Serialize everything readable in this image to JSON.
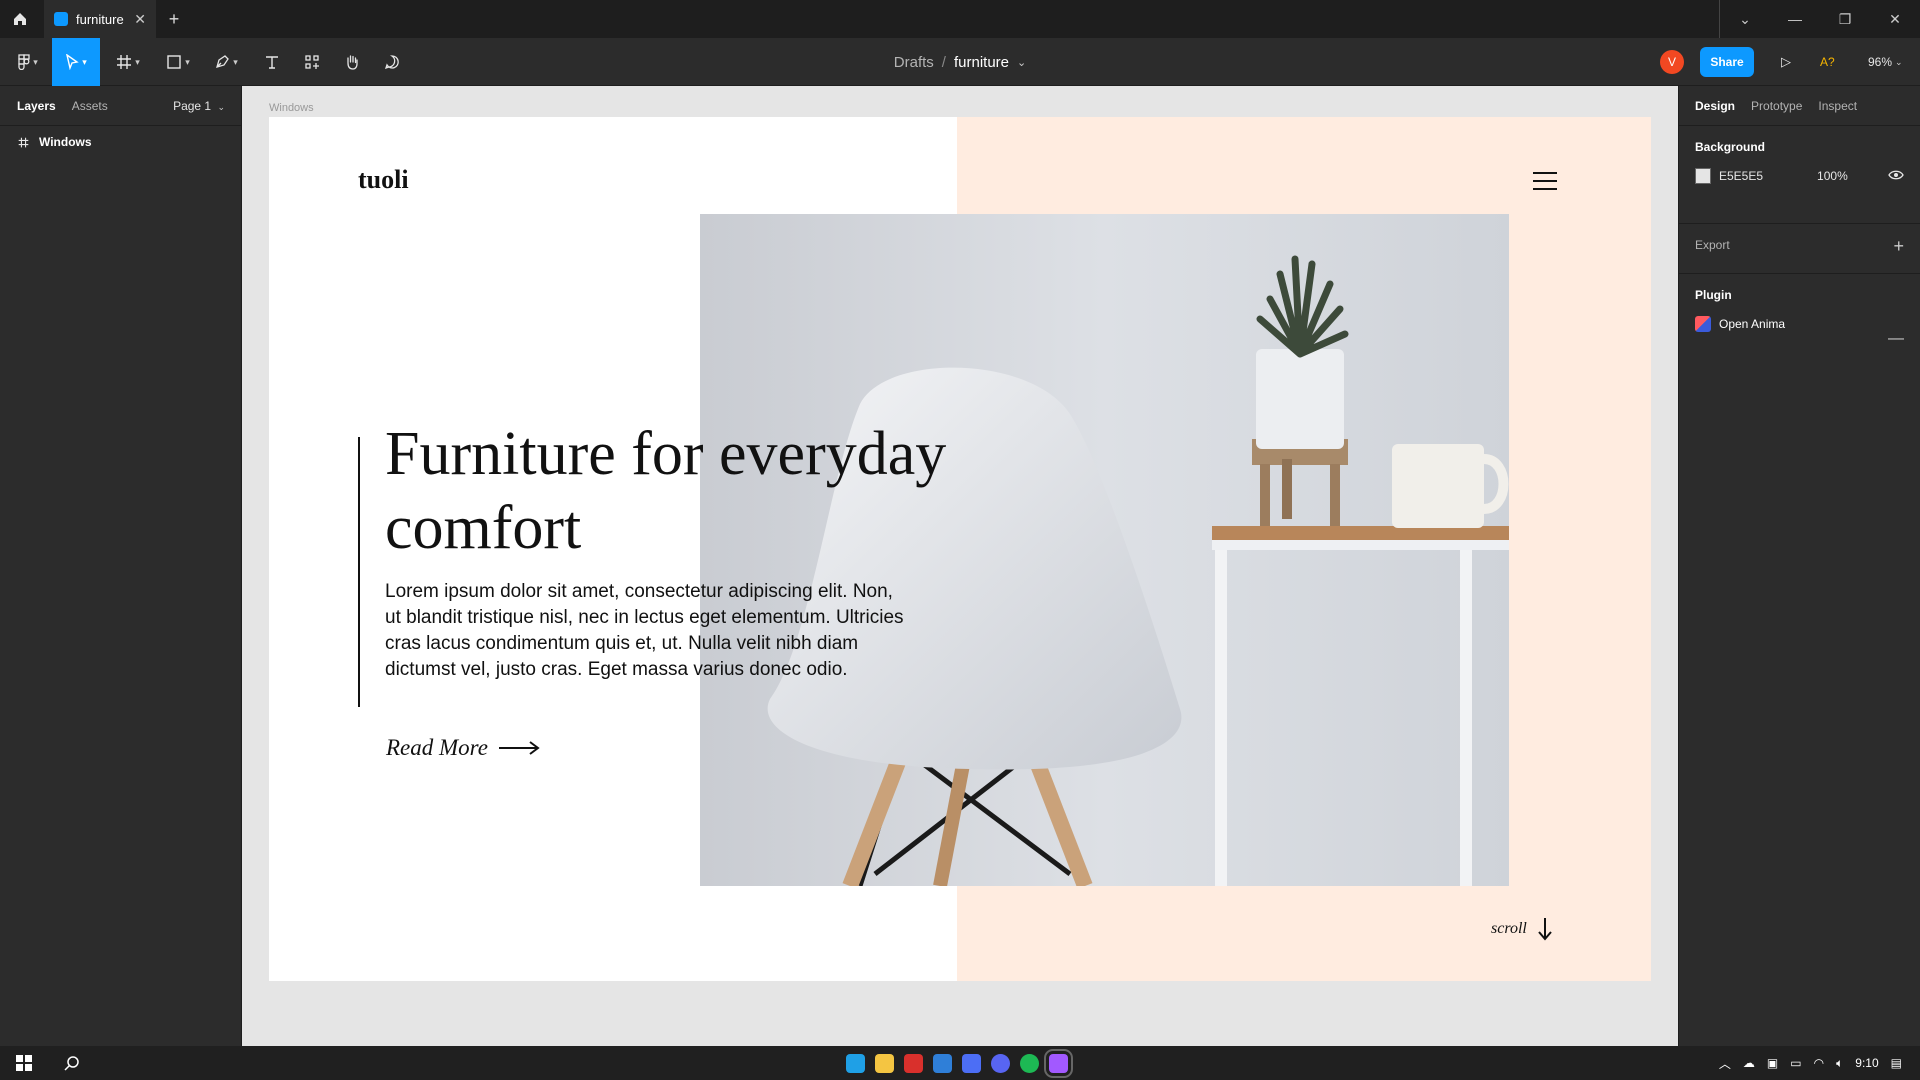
{
  "tabbar": {
    "tab_title": "furniture",
    "close_glyph": "✕",
    "new_tab_glyph": "+",
    "window_controls": {
      "chevron": "⌄",
      "minimize": "—",
      "restore": "❐",
      "close": "✕"
    }
  },
  "toolbar": {
    "breadcrumb_drafts": "Drafts",
    "breadcrumb_sep": "/",
    "breadcrumb_file": "furniture",
    "file_caret": "⌄",
    "avatar_initial": "V",
    "share_label": "Share",
    "play_glyph": "▷",
    "accessibility_label": "A?",
    "zoom_label": "96%",
    "zoom_caret": "⌄",
    "colors": {
      "accent": "#0d99ff",
      "avatar": "#f24822",
      "warning": "#f5b400"
    }
  },
  "left_panel": {
    "tabs": [
      "Layers",
      "Assets"
    ],
    "page_selector": "Page 1",
    "page_caret": "⌄",
    "layers": [
      {
        "icon": "frame-icon",
        "name": "Windows"
      }
    ]
  },
  "canvas": {
    "frame_label": "Windows",
    "design": {
      "logo": "tuoli",
      "headline": "Furniture for everyday comfort",
      "body": "Lorem ipsum dolor sit amet, consectetur adipiscing elit. Non, ut blandit tristique nisl, nec in lectus eget elementum. Ultricies cras lacus condimentum quis et, ut. Nulla velit nibh diam dictumst vel, justo cras. Eget massa varius donec odio.",
      "read_more": "Read More",
      "scroll": "scroll",
      "colors": {
        "peach": "#ffece0",
        "ink": "#111111"
      }
    }
  },
  "right_panel": {
    "tabs": [
      "Design",
      "Prototype",
      "Inspect"
    ],
    "background": {
      "title": "Background",
      "hex": "E5E5E5",
      "opacity": "100%",
      "visibility_icon": "eye-icon",
      "swatch_color": "#e5e5e5"
    },
    "export": {
      "title": "Export",
      "add_glyph": "+"
    },
    "plugin": {
      "title": "Plugin",
      "name": "Open Anima",
      "remove_glyph": "—"
    }
  },
  "help": {
    "glyph": "?"
  },
  "taskbar": {
    "apps": [
      {
        "name": "edge-icon",
        "color": "#1fa0e6"
      },
      {
        "name": "file-explorer-icon",
        "color": "#f4c542"
      },
      {
        "name": "app-icon",
        "color": "#d9302c"
      },
      {
        "name": "mail-icon",
        "color": "#2f7fd8"
      },
      {
        "name": "app-icon-2",
        "color": "#4c6ef5"
      },
      {
        "name": "discord-icon",
        "color": "#5865f2"
      },
      {
        "name": "spotify-icon",
        "color": "#1db954"
      },
      {
        "name": "figma-icon",
        "color": "#a259ff"
      }
    ],
    "time": "9:10"
  }
}
